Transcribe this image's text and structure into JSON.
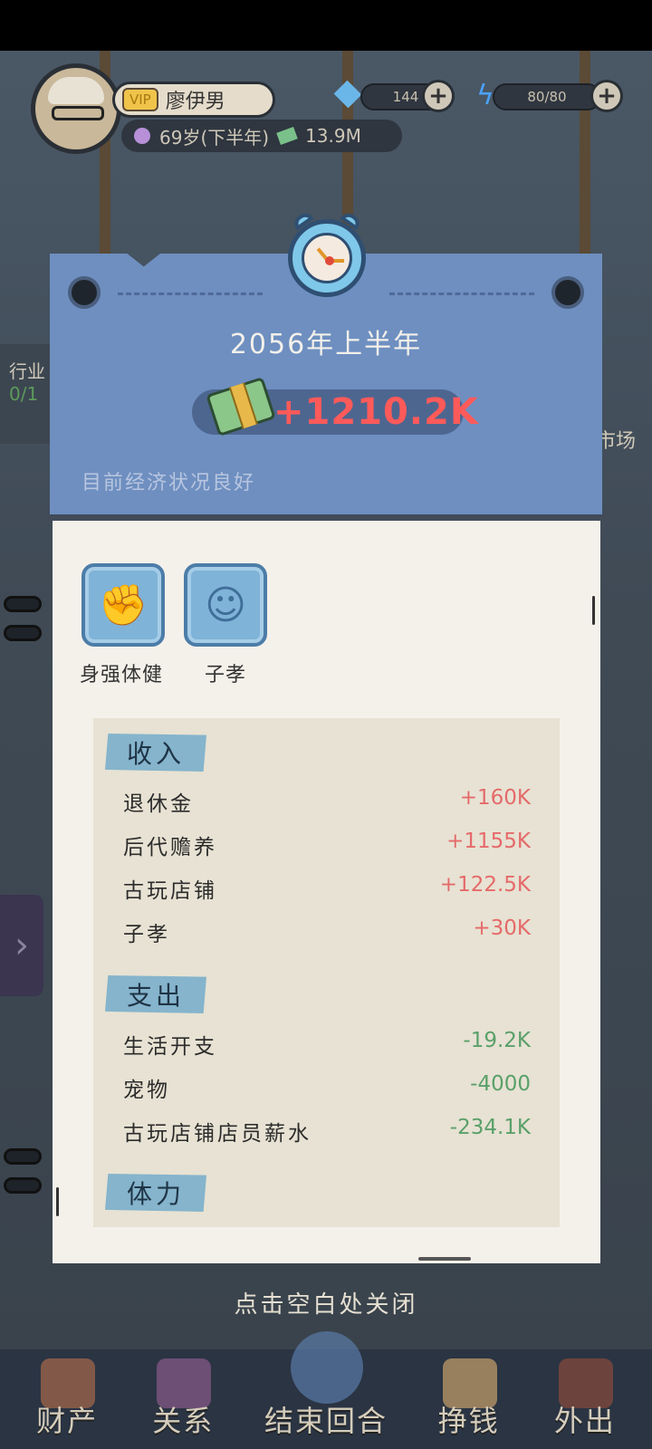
{
  "top": {
    "vip": "VIP",
    "player_name": "廖伊男",
    "age": "69岁(下半年)",
    "assets": "13.9M",
    "gems": "144",
    "energy": "80/80"
  },
  "background": {
    "side_left_label": "行业",
    "side_left_value": "0/1",
    "side_right_label": "市场"
  },
  "popup": {
    "period": "2056年上半年",
    "money_change": "+1210.2K",
    "economy_note": "目前经济状况良好",
    "traits": [
      {
        "label": "身强体健",
        "icon": "fist-icon"
      },
      {
        "label": "子孝",
        "icon": "child-head-icon"
      }
    ],
    "income": {
      "title": "收入",
      "rows": [
        {
          "label": "退休金",
          "value": "+160K"
        },
        {
          "label": "后代赡养",
          "value": "+1155K"
        },
        {
          "label": "古玩店铺",
          "value": "+122.5K"
        },
        {
          "label": "子孝",
          "value": "+30K"
        }
      ]
    },
    "expense": {
      "title": "支出",
      "rows": [
        {
          "label": "生活开支",
          "value": "-19.2K"
        },
        {
          "label": "宠物",
          "value": "-4000"
        },
        {
          "label": "古玩店铺店员薪水",
          "value": "-234.1K"
        }
      ]
    },
    "stamina_title": "体力",
    "close_hint": "点击空白处关闭"
  },
  "nav": {
    "assets": "财产",
    "relations": "关系",
    "end_turn": "结束回合",
    "earn": "挣钱",
    "go_out": "外出"
  },
  "colors": {
    "header_blue": "#6e8fc0",
    "income_red": "#e56a6a",
    "expense_green": "#5aa06a",
    "tag_blue": "#85b4cc"
  }
}
